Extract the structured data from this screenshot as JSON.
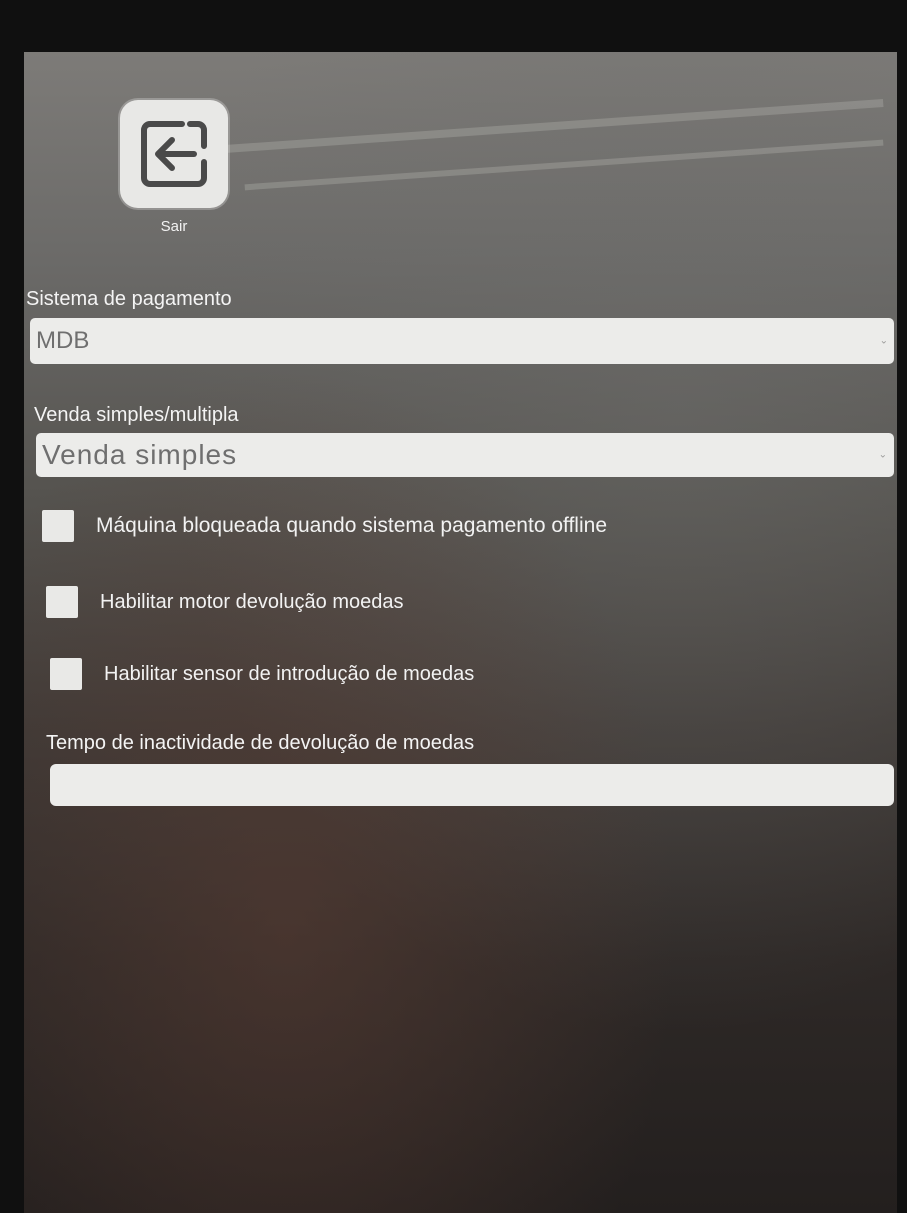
{
  "exit": {
    "label": "Sair",
    "icon": "exit-arrow-icon"
  },
  "payment_system": {
    "label": "Sistema de pagamento",
    "selected": "MDB"
  },
  "sale_mode": {
    "label": "Venda simples/multipla",
    "selected": "Venda simples"
  },
  "checkboxes": [
    {
      "label": "Máquina bloqueada quando sistema pagamento offline",
      "checked": false
    },
    {
      "label": "Habilitar motor devolução moedas",
      "checked": false
    },
    {
      "label": "Habilitar sensor de introdução de moedas",
      "checked": false
    }
  ],
  "inactivity_timeout": {
    "label": "Tempo de inactividade de devolução de moedas",
    "value": ""
  },
  "colors": {
    "field_background": "#ececea",
    "label_text": "#f4f4f4",
    "select_text": "#6f6f6f"
  }
}
